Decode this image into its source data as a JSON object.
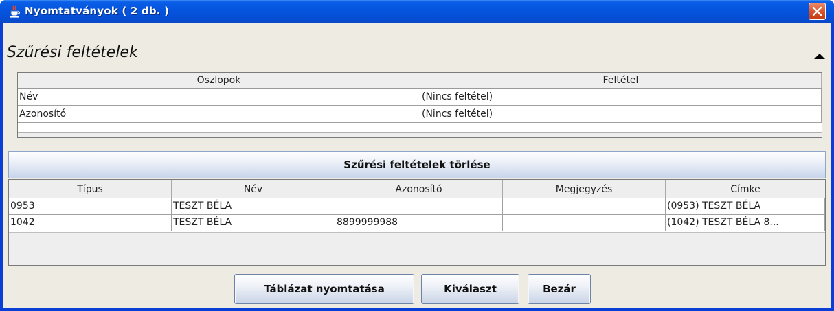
{
  "window": {
    "title": "Nyomtatványok  ( 2 db. )",
    "icon": "java-cup-icon"
  },
  "filter": {
    "title": "Szűrési feltételek",
    "columns": [
      "Oszlopok",
      "Feltétel"
    ],
    "rows": [
      [
        "Név",
        "(Nincs feltétel)"
      ],
      [
        "Azonosító",
        "(Nincs feltétel)"
      ]
    ],
    "clear_button": "Szűrési feltételek törlése"
  },
  "table": {
    "columns": [
      "Típus",
      "Név",
      "Azonosító",
      "Megjegyzés",
      "Címke"
    ],
    "rows": [
      [
        "0953",
        "TESZT BÉLA",
        "",
        "",
        "(0953) TESZT BÉLA"
      ],
      [
        "1042",
        "TESZT BÉLA",
        "8899999988",
        "",
        "(1042) TESZT BÉLA 8..."
      ]
    ]
  },
  "buttons": {
    "print": "Táblázat nyomtatása",
    "select": "Kiválaszt",
    "close": "Bezár"
  },
  "colors": {
    "titlebar": "#0655de",
    "client_bg": "#edebe2",
    "close_button": "#d8532c"
  }
}
